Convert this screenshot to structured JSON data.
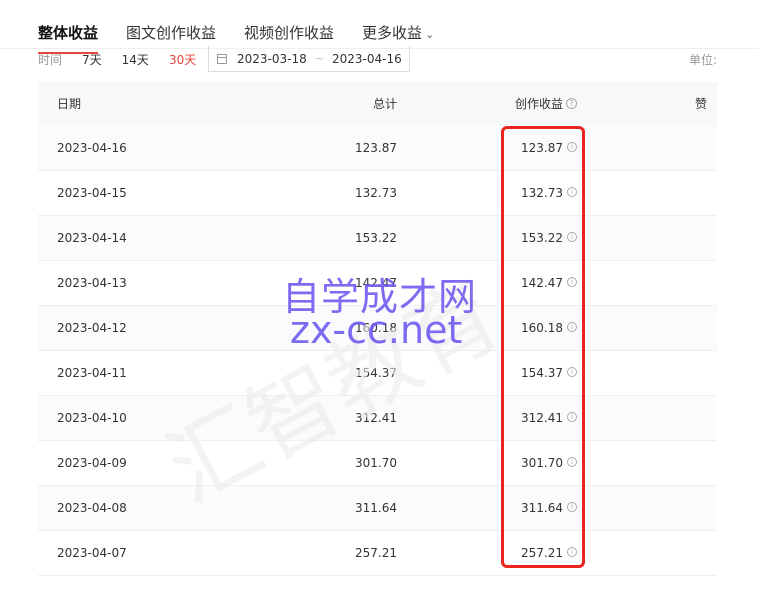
{
  "tabs": [
    {
      "label": "整体收益",
      "active": true
    },
    {
      "label": "图文创作收益",
      "active": false
    },
    {
      "label": "视频创作收益",
      "active": false
    },
    {
      "label": "更多收益",
      "active": false
    }
  ],
  "filters": {
    "time_label": "时间",
    "ranges": [
      {
        "label": "7天",
        "active": false
      },
      {
        "label": "14天",
        "active": false
      },
      {
        "label": "30天",
        "active": true
      }
    ],
    "date_start": "2023-03-18",
    "date_sep": "~",
    "date_end": "2023-04-16",
    "unit": "单位:"
  },
  "table": {
    "headers": {
      "date": "日期",
      "total": "总计",
      "creation": "创作收益",
      "reward": "赞赏"
    },
    "rows": [
      {
        "date": "2023-04-16",
        "total": "123.87",
        "creation": "123.87"
      },
      {
        "date": "2023-04-15",
        "total": "132.73",
        "creation": "132.73"
      },
      {
        "date": "2023-04-14",
        "total": "153.22",
        "creation": "153.22"
      },
      {
        "date": "2023-04-13",
        "total": "142.47",
        "creation": "142.47"
      },
      {
        "date": "2023-04-12",
        "total": "160.18",
        "creation": "160.18"
      },
      {
        "date": "2023-04-11",
        "total": "154.37",
        "creation": "154.37"
      },
      {
        "date": "2023-04-10",
        "total": "312.41",
        "creation": "312.41"
      },
      {
        "date": "2023-04-09",
        "total": "301.70",
        "creation": "301.70"
      },
      {
        "date": "2023-04-08",
        "total": "311.64",
        "creation": "311.64"
      },
      {
        "date": "2023-04-07",
        "total": "257.21",
        "creation": "257.21"
      }
    ]
  },
  "watermarks": {
    "line1": "自学成才网",
    "line2": "zx-cc.net",
    "line3": "汇智教育"
  },
  "icons": {
    "calendar": "calendar-icon",
    "info": "info-icon",
    "chevron": "chevron-down-icon"
  },
  "colors": {
    "accent": "#e8453c",
    "highlight": "#e8251e",
    "watermark": "#6f5bf0"
  }
}
